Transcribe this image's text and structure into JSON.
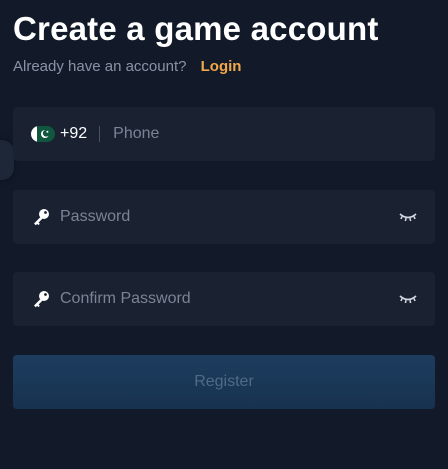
{
  "header": {
    "title": "Create a game account",
    "subtitle": "Already have an account?",
    "login_link": "Login"
  },
  "form": {
    "phone": {
      "country_flag": "pakistan-flag-icon",
      "dial_code": "+92",
      "placeholder": "Phone",
      "value": ""
    },
    "password": {
      "icon": "key-icon",
      "placeholder": "Password",
      "value": "",
      "toggle_icon": "eye-closed-icon"
    },
    "confirm_password": {
      "icon": "key-icon",
      "placeholder": "Confirm Password",
      "value": "",
      "toggle_icon": "eye-closed-icon"
    },
    "register_label": "Register"
  },
  "colors": {
    "background": "#121a2a",
    "field_background": "#1a2232",
    "accent": "#f0a84a",
    "button_background": "#1d3d5f",
    "button_text": "#4f6b88"
  }
}
